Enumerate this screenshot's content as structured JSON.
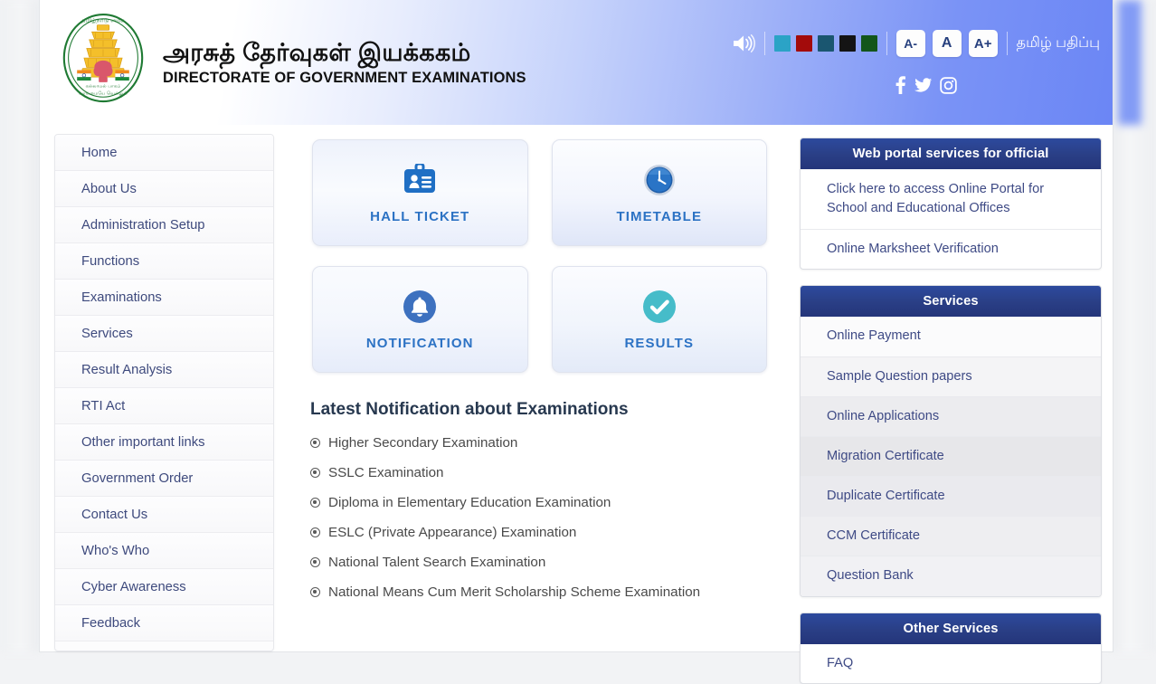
{
  "header": {
    "emblem_name": "tamil-nadu-government-emblem",
    "title_tamil": "அரசுத் தேர்வுகள் இயக்ககம்",
    "title_english": "DIRECTORATE OF GOVERNMENT EXAMINATIONS",
    "speaker_icon": "speaker-icon",
    "theme_swatches": [
      {
        "name": "theme-cyan",
        "color": "#2BA3C6"
      },
      {
        "name": "theme-dark-red",
        "color": "#A30B0B"
      },
      {
        "name": "theme-dark-teal",
        "color": "#1A5670"
      },
      {
        "name": "theme-black",
        "color": "#141414"
      },
      {
        "name": "theme-dark-green",
        "color": "#13561A"
      }
    ],
    "font_buttons": [
      {
        "name": "font-decrease-button",
        "label": "A-"
      },
      {
        "name": "font-normal-button",
        "label": "A"
      },
      {
        "name": "font-increase-button",
        "label": "A+"
      }
    ],
    "tamil_version_label": "தமிழ் பதிப்பு",
    "social": [
      {
        "name": "facebook-icon",
        "label": "Facebook"
      },
      {
        "name": "twitter-icon",
        "label": "Twitter"
      },
      {
        "name": "instagram-icon",
        "label": "Instagram"
      }
    ]
  },
  "sidebar": {
    "items": [
      {
        "label": "Home"
      },
      {
        "label": "About Us"
      },
      {
        "label": "Administration Setup"
      },
      {
        "label": "Functions"
      },
      {
        "label": "Examinations"
      },
      {
        "label": "Services"
      },
      {
        "label": "Result Analysis"
      },
      {
        "label": "RTI Act"
      },
      {
        "label": "Other important links"
      },
      {
        "label": "Government Order"
      },
      {
        "label": "Contact Us"
      },
      {
        "label": "Who's Who"
      },
      {
        "label": "Cyber Awareness"
      },
      {
        "label": "Feedback"
      }
    ]
  },
  "cards": [
    {
      "label": "HALL TICKET",
      "icon": "id-badge-icon",
      "color": "#2c72c4"
    },
    {
      "label": "TIMETABLE",
      "icon": "clock-icon",
      "color": "#2c72c4"
    },
    {
      "label": "NOTIFICATION",
      "icon": "bell-icon",
      "color": "#2c72c4"
    },
    {
      "label": "RESULTS",
      "icon": "check-circle-icon",
      "color": "#2c72c4"
    }
  ],
  "notifications": {
    "title": "Latest Notification about Examinations",
    "items": [
      {
        "label": "Higher Secondary Examination"
      },
      {
        "label": "SSLC Examination"
      },
      {
        "label": "Diploma in Elementary Education Examination"
      },
      {
        "label": "ESLC (Private Appearance) Examination"
      },
      {
        "label": "National Talent Search Examination"
      },
      {
        "label": "National Means Cum Merit Scholarship Scheme Examination"
      }
    ]
  },
  "right_panels": [
    {
      "title": "Web portal services for official",
      "links": [
        {
          "label": "Click here to access Online Portal for School and Educational Offices"
        },
        {
          "label": "Online Marksheet Verification"
        }
      ]
    },
    {
      "title": "Services",
      "links": [
        {
          "label": "Online Payment"
        },
        {
          "label": "Sample Question papers"
        },
        {
          "label": "Online Applications"
        },
        {
          "label": "Migration Certificate"
        },
        {
          "label": "Duplicate Certificate"
        },
        {
          "label": "CCM Certificate"
        },
        {
          "label": "Question Bank"
        }
      ]
    },
    {
      "title": "Other Services",
      "links": [
        {
          "label": "FAQ"
        }
      ]
    }
  ]
}
